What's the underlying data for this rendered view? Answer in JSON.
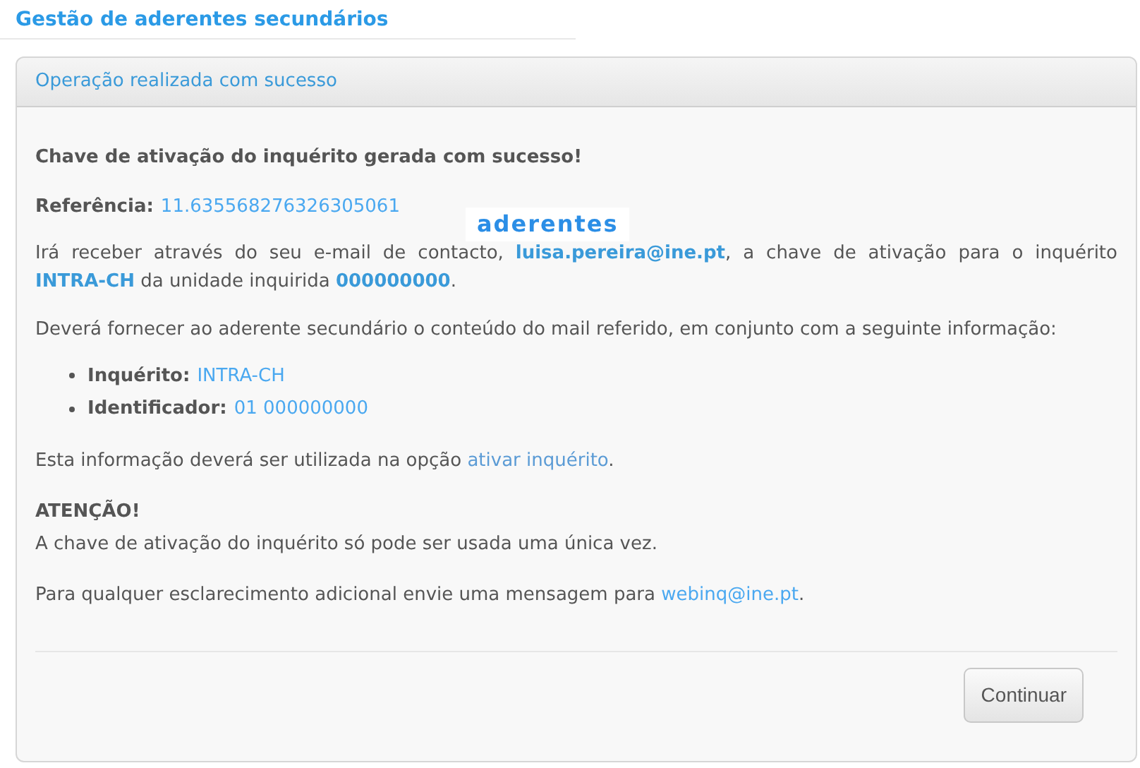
{
  "page_title": "Gestão de aderentes secundários",
  "panel": {
    "header": "Operação realizada com sucesso",
    "heading": "Chave de ativação do inquérito gerada com sucesso!",
    "reference": {
      "label": "Referência:",
      "value": "11.635568276326305061"
    },
    "overlay_label": "aderentes",
    "email_paragraph": {
      "before": "Irá receber através do seu e-mail de contacto,",
      "email": "luisa.pereira@ine.pt",
      "middle": ", a chave de ativação para o inquérito",
      "survey": "INTRA-CH",
      "after_survey": "da unidade inquirida",
      "unit": "000000000",
      "end": "."
    },
    "instruction": "Deverá fornecer ao aderente secundário o conteúdo do mail referido, em conjunto com a seguinte informação:",
    "info_items": [
      {
        "label": "Inquérito:",
        "value": "INTRA-CH"
      },
      {
        "label": "Identificador:",
        "value": "01 000000000"
      }
    ],
    "usage": {
      "before": "Esta informação deverá ser utilizada na opção",
      "link": "ativar inquérito",
      "end": "."
    },
    "warning_title": "ATENÇÃO!",
    "warning_text": "A chave de ativação do inquérito só pode ser usada uma única vez.",
    "contact": {
      "before": "Para qualquer esclarecimento adicional envie uma mensagem para",
      "link": "webinq@ine.pt",
      "end": "."
    },
    "button": "Continuar"
  }
}
